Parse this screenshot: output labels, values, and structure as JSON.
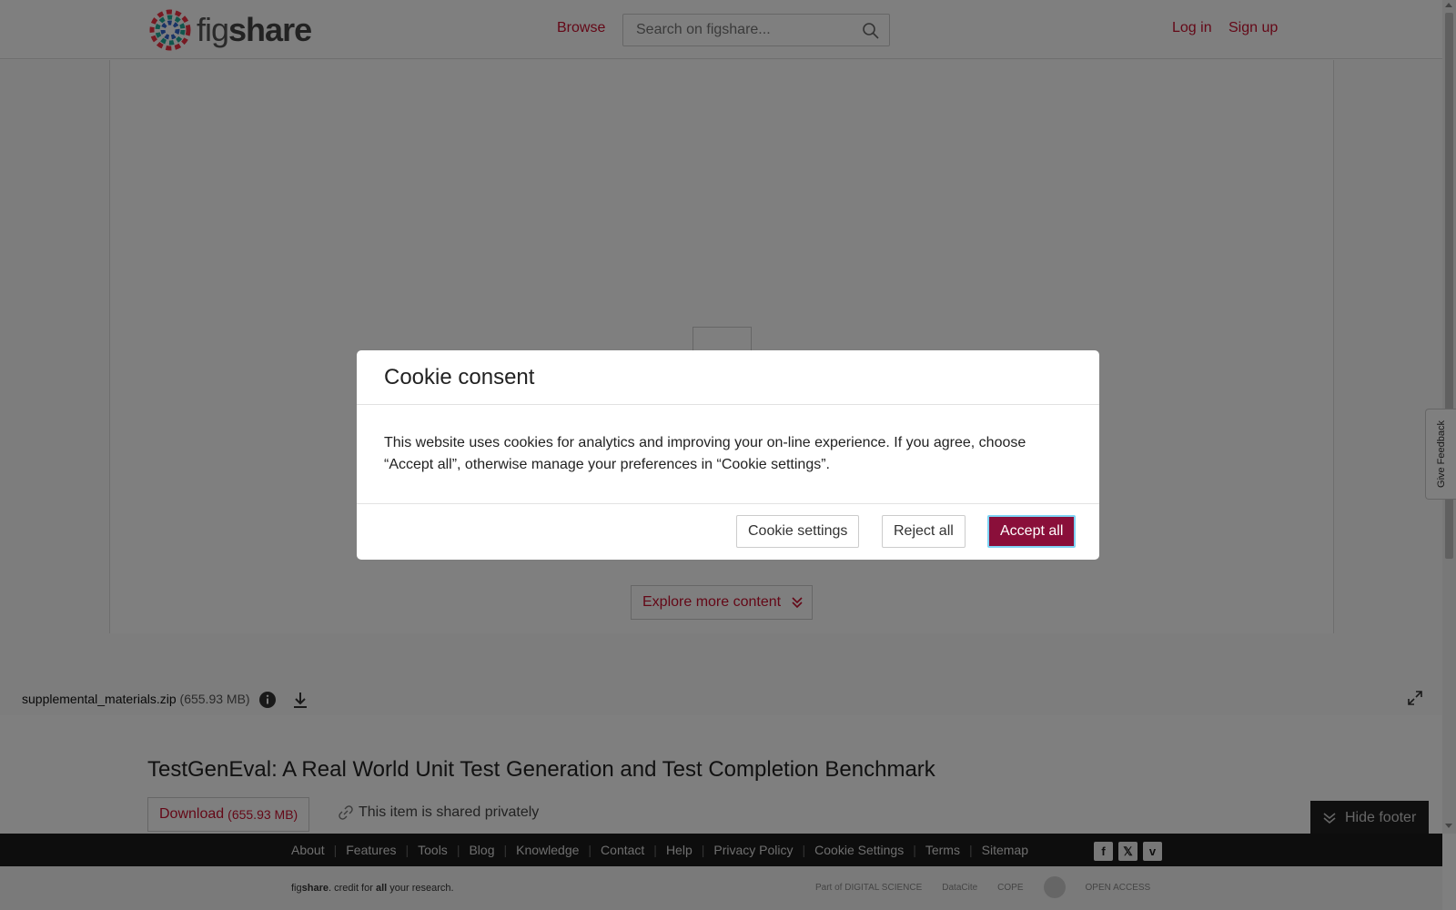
{
  "header": {
    "logo_text_light": "fig",
    "logo_text_bold": "share",
    "browse": "Browse",
    "search_placeholder": "Search on figshare...",
    "login": "Log in",
    "signup": "Sign up"
  },
  "viewer": {
    "explore_label": "Explore more content",
    "file_name": "supplemental_materials.zip",
    "file_size": "(655.93 MB)"
  },
  "item": {
    "title": "TestGenEval: A Real World Unit Test Generation and Test Completion Benchmark",
    "download_label": "Download",
    "download_size": "(655.93 MB)",
    "shared_text": "This item is shared privately"
  },
  "hide_footer": "Hide footer",
  "feedback": "Give Feedback",
  "footer": {
    "links": [
      "About",
      "Features",
      "Tools",
      "Blog",
      "Knowledge",
      "Contact",
      "Help",
      "Privacy Policy",
      "Cookie Settings",
      "Terms",
      "Sitemap"
    ],
    "tagline_fig": "fig",
    "tagline_share": "share",
    "tagline_mid": ". credit for ",
    "tagline_all": "all",
    "tagline_end": " your research.",
    "partners": [
      "Part of DIGITAL SCIENCE",
      "DataCite",
      "COPE",
      "",
      "OPEN ACCESS"
    ]
  },
  "modal": {
    "title": "Cookie consent",
    "body": "This website uses cookies for analytics and improving your on-line experience. If you agree, choose “Accept all”, otherwise manage your preferences in “Cookie settings”.",
    "cookie_settings": "Cookie settings",
    "reject_all": "Reject all",
    "accept_all": "Accept all"
  },
  "colors": {
    "brand": "#c8102e",
    "accept": "#8a0f3a"
  }
}
